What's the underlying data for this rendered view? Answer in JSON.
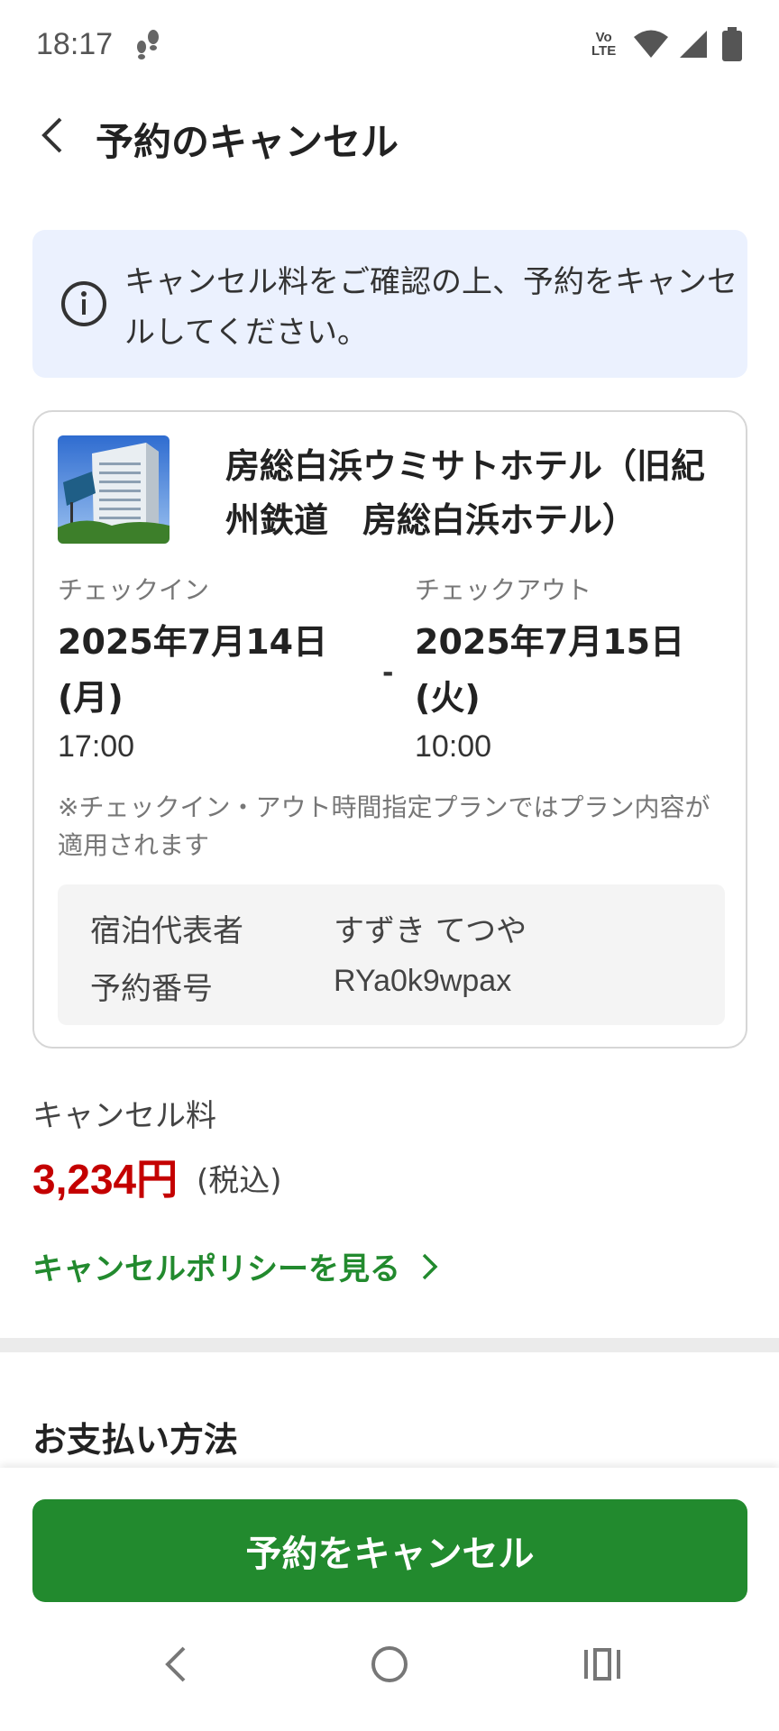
{
  "status_bar": {
    "time": "18:17",
    "volte_line1": "Vo",
    "volte_line2": "LTE",
    "icons": [
      "steps-icon",
      "wifi-icon",
      "signal-icon",
      "battery-icon"
    ]
  },
  "header": {
    "title": "予約のキャンセル",
    "back_icon": "chevron-left-icon"
  },
  "info_banner": {
    "icon": "info-icon",
    "text": "キャンセル料をご確認の上、予約をキャンセルしてください。"
  },
  "booking": {
    "hotel_name": "房総白浜ウミサトホテル（旧紀州鉄道　房総白浜ホテル）",
    "checkin": {
      "label": "チェックイン",
      "date_line1": "2025年7月14日",
      "date_line2": "(月)",
      "time": "17:00"
    },
    "separator": "-",
    "checkout": {
      "label": "チェックアウト",
      "date_line1": "2025年7月15日",
      "date_line2": "(火)",
      "time": "10:00"
    },
    "note": "※チェックイン・アウト時間指定プランではプラン内容が適用されます",
    "guest": {
      "rep_label": "宿泊代表者",
      "rep_value": "すずき てつや",
      "number_label": "予約番号",
      "number_value": "RYa0k9wpax"
    }
  },
  "cancel_fee": {
    "label": "キャンセル料",
    "amount": "3,234円",
    "tax_note": "(税込)",
    "policy_link": "キャンセルポリシーを見る"
  },
  "payment": {
    "title": "お支払い方法"
  },
  "cancel_button": {
    "label": "予約をキャンセル"
  },
  "colors": {
    "primary_green": "#228a2e",
    "fee_red": "#c40000",
    "info_bg": "#ebf1fe"
  },
  "nav": {
    "icons": [
      "nav-back-icon",
      "nav-home-icon",
      "nav-recents-icon"
    ]
  }
}
